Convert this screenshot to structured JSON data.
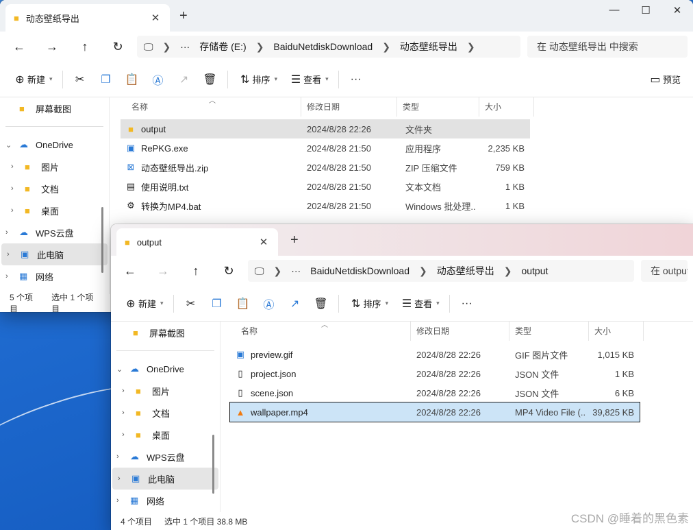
{
  "win1": {
    "tab_title": "动态壁纸导出",
    "path": [
      "···",
      "存储卷 (E:)",
      "BaiduNetdiskDownload",
      "动态壁纸导出"
    ],
    "search_placeholder": "在 动态壁纸导出 中搜索",
    "toolbar": {
      "new_label": "新建",
      "sort_label": "排序",
      "view_label": "查看",
      "preview_label": "预览"
    },
    "nav": [
      {
        "label": "屏幕截图",
        "icon": "folder-icon"
      },
      {
        "label": "OneDrive",
        "icon": "cloud-icon"
      },
      {
        "label": "图片",
        "icon": "folder-icon"
      },
      {
        "label": "文档",
        "icon": "folder-icon"
      },
      {
        "label": "桌面",
        "icon": "folder-icon"
      },
      {
        "label": "WPS云盘",
        "icon": "wps-cloud-icon"
      },
      {
        "label": "此电脑",
        "icon": "computer-icon"
      },
      {
        "label": "网络",
        "icon": "network-icon"
      }
    ],
    "columns": [
      "名称",
      "修改日期",
      "类型",
      "大小"
    ],
    "files": [
      {
        "name": "output",
        "date": "2024/8/28 22:26",
        "type": "文件夹",
        "size": "",
        "icon": "folder-icon"
      },
      {
        "name": "RePKG.exe",
        "date": "2024/8/28 21:50",
        "type": "应用程序",
        "size": "2,235 KB",
        "icon": "exe-icon"
      },
      {
        "name": "动态壁纸导出.zip",
        "date": "2024/8/28 21:50",
        "type": "ZIP 压缩文件",
        "size": "759 KB",
        "icon": "zip-icon"
      },
      {
        "name": "使用说明.txt",
        "date": "2024/8/28 21:50",
        "type": "文本文档",
        "size": "1 KB",
        "icon": "txt-icon"
      },
      {
        "name": "转换为MP4.bat",
        "date": "2024/8/28 21:50",
        "type": "Windows 批处理...",
        "size": "1 KB",
        "icon": "bat-icon"
      }
    ],
    "status": {
      "count": "5 个项目",
      "selected": "选中 1 个项目"
    }
  },
  "win2": {
    "tab_title": "output",
    "path": [
      "···",
      "BaiduNetdiskDownload",
      "动态壁纸导出",
      "output"
    ],
    "search_placeholder": "在 output 中搜索",
    "toolbar": {
      "new_label": "新建",
      "sort_label": "排序",
      "view_label": "查看"
    },
    "nav": [
      {
        "label": "屏幕截图",
        "icon": "folder-icon"
      },
      {
        "label": "OneDrive",
        "icon": "cloud-icon"
      },
      {
        "label": "图片",
        "icon": "folder-icon"
      },
      {
        "label": "文档",
        "icon": "folder-icon"
      },
      {
        "label": "桌面",
        "icon": "folder-icon"
      },
      {
        "label": "WPS云盘",
        "icon": "wps-cloud-icon"
      },
      {
        "label": "此电脑",
        "icon": "computer-icon"
      },
      {
        "label": "网络",
        "icon": "network-icon"
      }
    ],
    "columns": [
      "名称",
      "修改日期",
      "类型",
      "大小"
    ],
    "files": [
      {
        "name": "preview.gif",
        "date": "2024/8/28 22:26",
        "type": "GIF 图片文件",
        "size": "1,015 KB",
        "icon": "gif-icon"
      },
      {
        "name": "project.json",
        "date": "2024/8/28 22:26",
        "type": "JSON 文件",
        "size": "1 KB",
        "icon": "file-icon"
      },
      {
        "name": "scene.json",
        "date": "2024/8/28 22:26",
        "type": "JSON 文件",
        "size": "6 KB",
        "icon": "file-icon"
      },
      {
        "name": "wallpaper.mp4",
        "date": "2024/8/28 22:26",
        "type": "MP4 Video File (...",
        "size": "39,825 KB",
        "icon": "vlc-icon"
      }
    ],
    "status": {
      "count": "4 个项目",
      "selected": "选中 1 个项目 38.8 MB"
    }
  },
  "watermark": "CSDN @睡着的黑色素",
  "colors": {
    "selection": "#cce4f7",
    "folder": "#f2b824",
    "accent": "#2a7ad6"
  }
}
